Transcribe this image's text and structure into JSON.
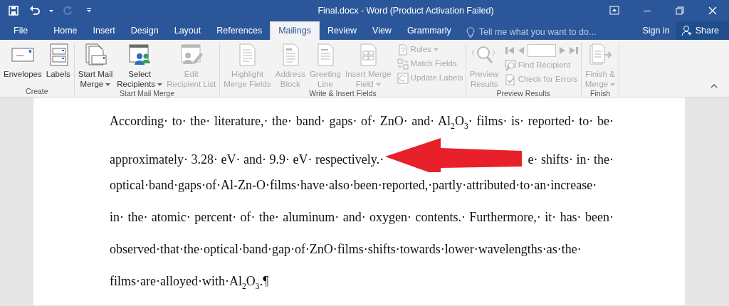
{
  "window": {
    "title": "Final.docx - Word (Product Activation Failed)"
  },
  "quick_access": [
    {
      "kind": "save",
      "disabled": false
    },
    {
      "kind": "undo",
      "disabled": false
    },
    {
      "kind": "redo",
      "disabled": true
    },
    {
      "kind": "customize",
      "disabled": false
    }
  ],
  "tabs": [
    {
      "label": "File",
      "selected": false
    },
    {
      "label": "Home",
      "selected": false
    },
    {
      "label": "Insert",
      "selected": false
    },
    {
      "label": "Design",
      "selected": false
    },
    {
      "label": "Layout",
      "selected": false
    },
    {
      "label": "References",
      "selected": false
    },
    {
      "label": "Mailings",
      "selected": true
    },
    {
      "label": "Review",
      "selected": false
    },
    {
      "label": "View",
      "selected": false
    },
    {
      "label": "Grammarly",
      "selected": false
    }
  ],
  "tell_me": {
    "placeholder": "Tell me what you want to do..."
  },
  "sign_in": "Sign in",
  "share": "Share",
  "ribbon": [
    {
      "label": "Create",
      "items": [
        {
          "kind": "large",
          "label": "Envelopes",
          "dropdown": false,
          "disabled": false
        },
        {
          "kind": "large",
          "label": "Labels",
          "dropdown": false,
          "disabled": false
        }
      ]
    },
    {
      "label": "Start Mail Merge",
      "items": [
        {
          "kind": "large",
          "label": "Start Mail\nMerge",
          "dropdown": true,
          "disabled": false
        },
        {
          "kind": "large",
          "label": "Select\nRecipients",
          "dropdown": true,
          "disabled": false
        },
        {
          "kind": "large",
          "label": "Edit\nRecipient List",
          "dropdown": false,
          "disabled": true
        }
      ]
    },
    {
      "label": "Write & Insert Fields",
      "items": [
        {
          "kind": "large",
          "label": "Highlight\nMerge Fields",
          "dropdown": false,
          "disabled": true
        },
        {
          "kind": "large",
          "label": "Address\nBlock",
          "dropdown": false,
          "disabled": true
        },
        {
          "kind": "large",
          "label": "Greeting\nLine",
          "dropdown": false,
          "disabled": true
        },
        {
          "kind": "large",
          "label": "Insert Merge\nField",
          "dropdown": true,
          "disabled": true
        },
        {
          "kind": "stack",
          "rows": [
            {
              "kind": "small",
              "label": "Rules",
              "dropdown": true,
              "disabled": true
            },
            {
              "kind": "small",
              "label": "Match Fields",
              "dropdown": false,
              "disabled": true
            },
            {
              "kind": "small",
              "label": "Update Labels",
              "dropdown": false,
              "disabled": true
            }
          ]
        }
      ]
    },
    {
      "label": "Preview Results",
      "items": [
        {
          "kind": "large",
          "label": "Preview\nResults",
          "dropdown": false,
          "disabled": true
        },
        {
          "kind": "stack",
          "rows": [
            {
              "kind": "nav",
              "disabled": true
            },
            {
              "kind": "small",
              "label": "Find Recipient",
              "dropdown": false,
              "disabled": true
            },
            {
              "kind": "small",
              "label": "Check for Errors",
              "dropdown": false,
              "disabled": true
            }
          ]
        }
      ]
    },
    {
      "label": "Finish",
      "items": [
        {
          "kind": "large",
          "label": "Finish &\nMerge",
          "dropdown": true,
          "disabled": true
        }
      ]
    }
  ],
  "document": {
    "lines": [
      {
        "kind": "text",
        "text": "According· to· the· literature,· the· band· gaps· of· ZnO· and· Al$_{2}$O$_{3}$· films· is· reported· to· be·"
      },
      {
        "kind": "covered",
        "segments": [
          "approximately· 3.28· eV· and· 9.9· eV· respectively.·",
          "e· shifts· in· the·"
        ]
      },
      {
        "kind": "text",
        "text": "optical·band·gaps·of·Al-Zn-O·films·have·also·been·reported,·partly·attributed·to·an·increase·"
      },
      {
        "kind": "text",
        "text": "in· the· atomic· percent· of· the· aluminum· and· oxygen· contents.· Furthermore,· it· has· been·"
      },
      {
        "kind": "text",
        "text": "observed·that·the·optical·band·gap·of·ZnO·films·shifts·towards·lower·wavelengths·as·the·"
      },
      {
        "kind": "text",
        "text": "films·are·alloyed·with·Al$_{2}$O$_{3}$.¶"
      }
    ]
  }
}
